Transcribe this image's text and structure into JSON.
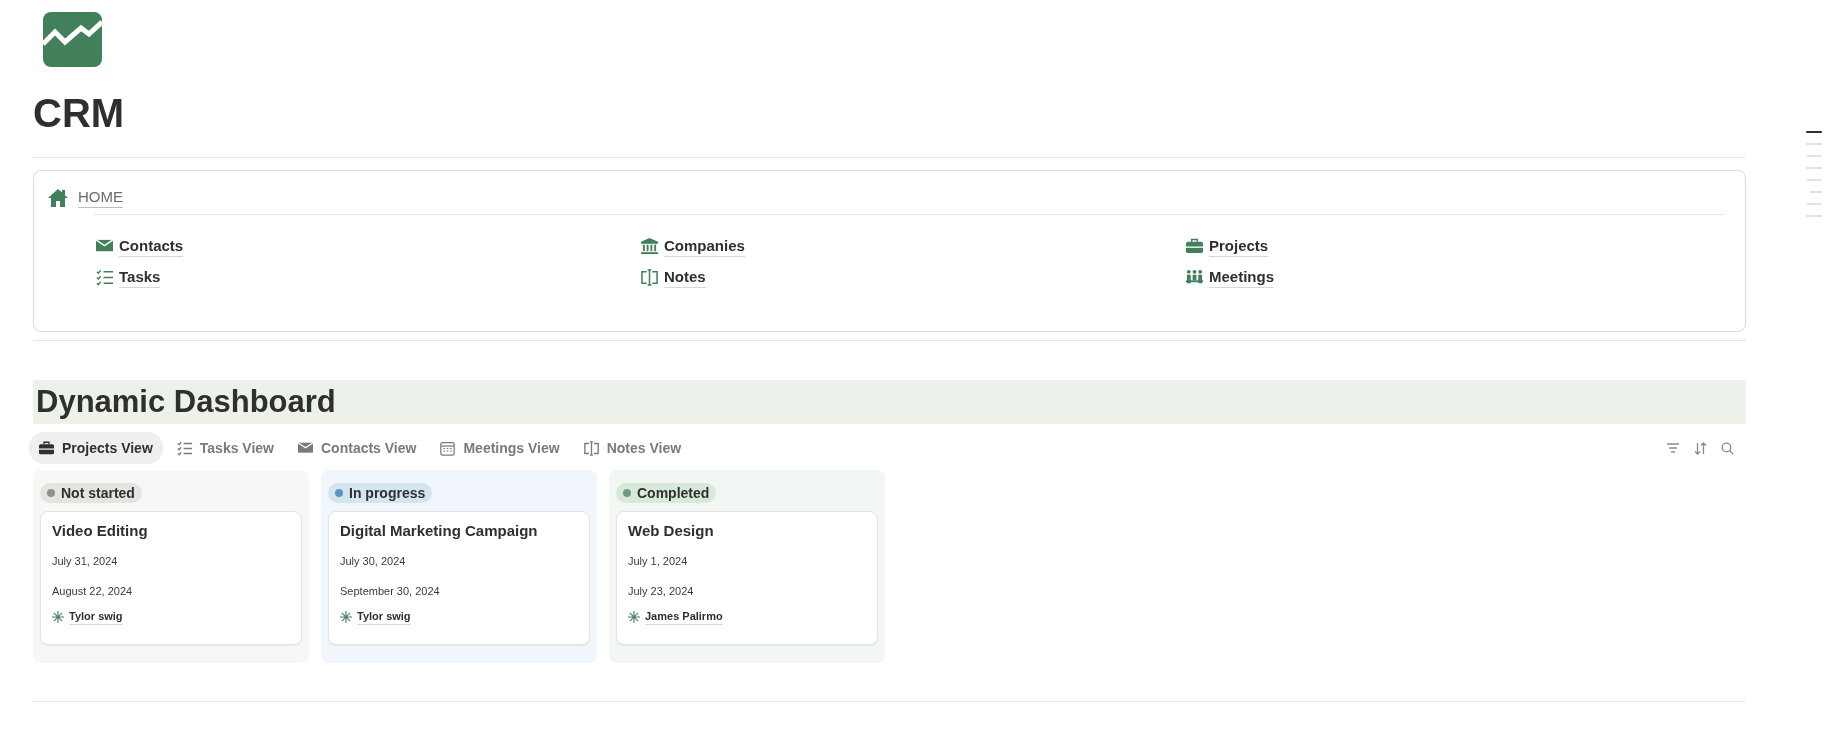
{
  "page": {
    "title": "CRM"
  },
  "home": {
    "label": "HOME",
    "links": [
      {
        "label": "Contacts",
        "kind": "mail"
      },
      {
        "label": "Companies",
        "kind": "bank"
      },
      {
        "label": "Projects",
        "kind": "briefcase"
      },
      {
        "label": "Tasks",
        "kind": "tasks"
      },
      {
        "label": "Notes",
        "kind": "notes"
      },
      {
        "label": "Meetings",
        "kind": "people"
      }
    ]
  },
  "dashboard": {
    "title": "Dynamic Dashboard",
    "tabs": [
      {
        "label": "Projects View",
        "kind": "briefcase",
        "selected": true
      },
      {
        "label": "Tasks View",
        "kind": "tasks",
        "selected": false
      },
      {
        "label": "Contacts View",
        "kind": "mail",
        "selected": false
      },
      {
        "label": "Meetings View",
        "kind": "calendar",
        "selected": false
      },
      {
        "label": "Notes View",
        "kind": "notes",
        "selected": false
      }
    ],
    "columns": [
      {
        "status": "Not started",
        "color": "#91918e",
        "cards": [
          {
            "title": "Video Editing",
            "start": "July 31, 2024",
            "end": "August 22, 2024",
            "owner": "Tylor swig"
          }
        ]
      },
      {
        "status": "In progress",
        "color": "#5b97bd",
        "cards": [
          {
            "title": "Digital Marketing Campaign",
            "start": "July 30, 2024",
            "end": "September 30, 2024",
            "owner": "Tylor swig"
          }
        ]
      },
      {
        "status": "Completed",
        "color": "#6c9b7d",
        "cards": [
          {
            "title": "Web Design",
            "start": "July 1, 2024",
            "end": "July 23, 2024",
            "owner": "James Palirmo"
          }
        ]
      }
    ]
  },
  "outline_markers": [
    {
      "kind": "heading",
      "selected": true
    },
    {
      "kind": "heading",
      "selected": false
    },
    {
      "kind": "heading",
      "selected": false
    },
    {
      "kind": "heading",
      "selected": false
    },
    {
      "kind": "heading",
      "selected": false
    },
    {
      "kind": "subheading",
      "selected": false
    },
    {
      "kind": "heading",
      "selected": false
    },
    {
      "kind": "heading",
      "selected": false
    }
  ]
}
